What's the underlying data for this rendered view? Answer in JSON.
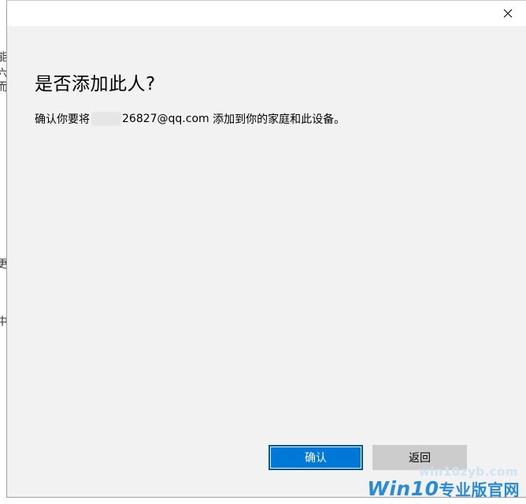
{
  "background": {
    "glyphs": [
      "能",
      "六",
      "而",
      "更",
      "中"
    ]
  },
  "dialog": {
    "close_icon": "close-icon",
    "heading": "是否添加此人?",
    "message": {
      "prefix": "确认你要将",
      "email_visible": "26827@qq.com",
      "suffix": " 添加到你的家庭和此设备。"
    },
    "buttons": {
      "confirm_label": "确认",
      "back_label": "返回"
    }
  },
  "watermark": {
    "small": "win10zyb.com",
    "big_latin": "Win10",
    "big_cn": "专业版官网"
  },
  "colors": {
    "dialog_bg": "#f2f2f2",
    "accent": "#0078d7",
    "secondary_button": "#cccccc",
    "watermark": "#2a8ad6"
  }
}
